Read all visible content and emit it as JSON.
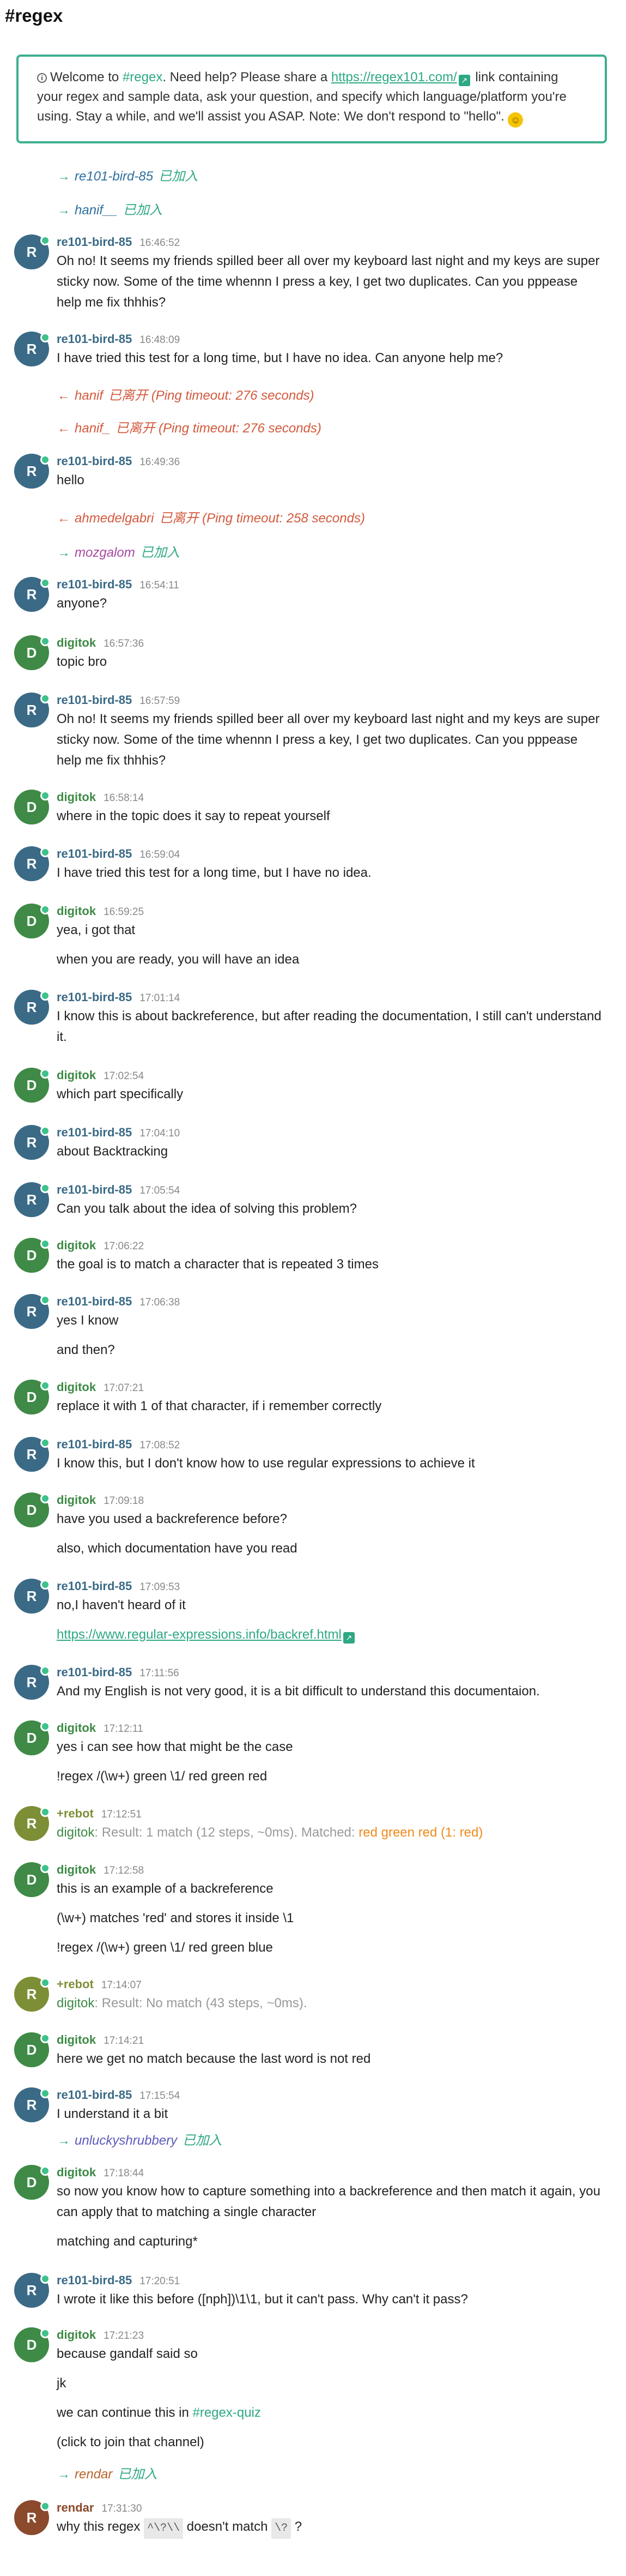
{
  "channel_title": "#regex",
  "topic": {
    "info_icon": "info-icon",
    "pre_channel": "Welcome to ",
    "channel_link": "#regex",
    "mid": ". Need help? Please share a ",
    "url": "https://regex101.com/",
    "post": " link containing your regex and sample data, ask your question, and specify which language/platform you're using. Stay a while, and we'll assist you ASAP. Note: We don't respond to \"hello\".",
    "emoji": "smile-emoji"
  },
  "colors": {
    "accent": "#2ea884",
    "re101": "#3a6a86",
    "digitok": "#3e8a46",
    "rebot": "#7d8f36",
    "rendar": "#8b4a2b",
    "hanif_join": "#2e6f9f",
    "mozgalom": "#a64aa0"
  },
  "events": [
    {
      "arrow": "→",
      "nick": "re101-bird-85",
      "text": "已加入"
    },
    {
      "arrow": "→",
      "nick": "hanif__",
      "text": "已加入"
    },
    {
      "arrow": "←",
      "nick": "hanif",
      "text": "已离开 (Ping timeout: 276 seconds)"
    },
    {
      "arrow": "←",
      "nick": "hanif_",
      "text": "已离开 (Ping timeout: 276 seconds)"
    },
    {
      "arrow": "←",
      "nick": "ahmedelgabri",
      "text": "已离开 (Ping timeout: 258 seconds)"
    },
    {
      "arrow": "→",
      "nick": "mozgalom",
      "text": "已加入"
    },
    {
      "arrow": "→",
      "nick": "unluckyshrubbery",
      "text": "已加入"
    },
    {
      "arrow": "→",
      "nick": "rendar",
      "text": "已加入"
    }
  ],
  "messages": [
    {
      "nick": "re101-bird-85",
      "initial": "R",
      "time": "16:46:52",
      "lines": [
        "Oh no! It seems my friends spilled beer all over my keyboard last night and my keys are super",
        "sticky now. Some of the time whennn I press a key, I get two duplicates. Can you pppease",
        "help me fix thhhis?"
      ]
    },
    {
      "nick": "re101-bird-85",
      "initial": "R",
      "time": "16:48:09",
      "lines": [
        "I have tried this test for a long time, but I have no idea. Can anyone help me?"
      ]
    },
    {
      "nick": "re101-bird-85",
      "initial": "R",
      "time": "16:49:36",
      "lines": [
        "hello"
      ]
    },
    {
      "nick": "re101-bird-85",
      "initial": "R",
      "time": "16:54:11",
      "lines": [
        "anyone?"
      ]
    },
    {
      "nick": "digitok",
      "initial": "D",
      "time": "16:57:36",
      "lines": [
        "topic bro"
      ]
    },
    {
      "nick": "re101-bird-85",
      "initial": "R",
      "time": "16:57:59",
      "lines": [
        "Oh no! It seems my friends spilled beer all over my keyboard last night and my keys are super",
        "sticky now. Some of the time whennn I press a key, I get two duplicates. Can you pppease",
        "help me fix thhhis?"
      ]
    },
    {
      "nick": "digitok",
      "initial": "D",
      "time": "16:58:14",
      "lines": [
        "where in the topic does it say to repeat yourself"
      ]
    },
    {
      "nick": "re101-bird-85",
      "initial": "R",
      "time": "16:59:04",
      "lines": [
        "I have tried this test for a long time, but I have no idea."
      ]
    },
    {
      "nick": "digitok",
      "initial": "D",
      "time": "16:59:25",
      "lines": [
        "yea, i got that",
        "when you are ready, you will have an idea"
      ]
    },
    {
      "nick": "re101-bird-85",
      "initial": "R",
      "time": "17:01:14",
      "lines": [
        "I know this is about backreference, but after reading the documentation, I still can't understand",
        "it."
      ]
    },
    {
      "nick": "digitok",
      "initial": "D",
      "time": "17:02:54",
      "lines": [
        "which part specifically"
      ]
    },
    {
      "nick": "re101-bird-85",
      "initial": "R",
      "time": "17:04:10",
      "lines": [
        "about Backtracking"
      ]
    },
    {
      "nick": "re101-bird-85",
      "initial": "R",
      "time": "17:05:54",
      "lines": [
        "Can you talk about the idea of solving this problem?"
      ]
    },
    {
      "nick": "digitok",
      "initial": "D",
      "time": "17:06:22",
      "lines": [
        "the goal is to match a character that is repeated 3 times"
      ]
    },
    {
      "nick": "re101-bird-85",
      "initial": "R",
      "time": "17:06:38",
      "lines": [
        "yes I know",
        "and then?"
      ]
    },
    {
      "nick": "digitok",
      "initial": "D",
      "time": "17:07:21",
      "lines": [
        "replace it with 1 of that character, if i remember correctly"
      ]
    },
    {
      "nick": "re101-bird-85",
      "initial": "R",
      "time": "17:08:52",
      "lines": [
        "I know this, but I don't know how to use regular expressions to achieve it"
      ]
    },
    {
      "nick": "digitok",
      "initial": "D",
      "time": "17:09:18",
      "lines": [
        "have you used a backreference before?",
        "also, which documentation have you read"
      ]
    },
    {
      "nick": "re101-bird-85",
      "initial": "R",
      "time": "17:09:53",
      "lines": [
        "no,I haven't heard of it",
        "https://www.regular-expressions.info/backref.html"
      ]
    },
    {
      "nick": "re101-bird-85",
      "initial": "R",
      "time": "17:11:56",
      "lines": [
        "And my English is not very good, it is a bit difficult to understand this documentaion."
      ]
    },
    {
      "nick": "digitok",
      "initial": "D",
      "time": "17:12:11",
      "lines": [
        "yes i can see how that might be the case",
        "!regex /(\\w+) green \\1/ red green red"
      ]
    },
    {
      "nick": "+rebot",
      "initial": "R",
      "time": "17:12:51",
      "bot_nick": "digitok",
      "bot_text": ": Result: 1 match (12 steps, ~0ms). Matched: ",
      "bot_match": "red green red (1: red)"
    },
    {
      "nick": "digitok",
      "initial": "D",
      "time": "17:12:58",
      "lines": [
        "this is an example of a backreference",
        "(\\w+) matches 'red' and stores it inside \\1",
        "!regex /(\\w+) green \\1/ red green blue"
      ]
    },
    {
      "nick": "+rebot",
      "initial": "R",
      "time": "17:14:07",
      "bot_nick": "digitok",
      "bot_text": ": Result: No match (43 steps, ~0ms).",
      "bot_match": ""
    },
    {
      "nick": "digitok",
      "initial": "D",
      "time": "17:14:21",
      "lines": [
        "here we get no match because the last word is not red"
      ]
    },
    {
      "nick": "re101-bird-85",
      "initial": "R",
      "time": "17:15:54",
      "lines": [
        "I understand it a bit"
      ]
    },
    {
      "nick": "digitok",
      "initial": "D",
      "time": "17:18:44",
      "lines": [
        "so now you know how to capture something into a backreference and then match it again, you",
        "can apply that to matching a single character",
        "matching and capturing*"
      ]
    },
    {
      "nick": "re101-bird-85",
      "initial": "R",
      "time": "17:20:51",
      "lines": [
        "I wrote it like this before ([nph])\\1\\1, but it can't pass. Why can't it pass?"
      ]
    },
    {
      "nick": "digitok",
      "initial": "D",
      "time": "17:21:23",
      "lines": [
        "because gandalf said so",
        "jk",
        "we can continue this in ",
        "(click to join that channel)"
      ],
      "channel_link": "#regex-quiz"
    },
    {
      "nick": "rendar",
      "initial": "R",
      "time": "17:31:30",
      "lines": [
        "why this regex ",
        " doesn't match ",
        " ?"
      ],
      "code1": "^\\?\\\\",
      "code2": "\\?"
    }
  ]
}
